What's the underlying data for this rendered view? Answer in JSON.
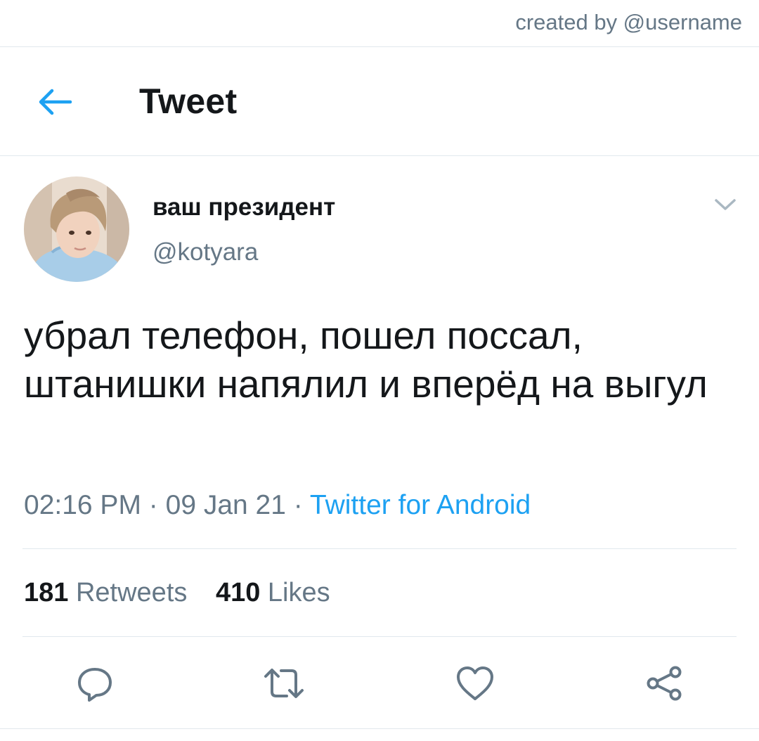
{
  "credit": "created by @username",
  "header": {
    "title": "Tweet",
    "back_icon": "arrow-left-icon"
  },
  "tweet": {
    "display_name": "ваш президент",
    "handle": "@kotyara",
    "text": "убрал телефон, пошел поссал, штанишки напялил и вперёд на выгул",
    "time": "02:16 PM",
    "date": "09 Jan 21",
    "separator": "·",
    "source": "Twitter for Android",
    "retweets_count": "181",
    "retweets_label": "Retweets",
    "likes_count": "410",
    "likes_label": "Likes"
  },
  "actions": [
    {
      "icon": "reply-icon"
    },
    {
      "icon": "retweet-icon"
    },
    {
      "icon": "like-icon"
    },
    {
      "icon": "share-icon"
    }
  ],
  "colors": {
    "accent": "#1da1f2",
    "text": "#14171a",
    "secondary": "#657786",
    "divider": "#e1e8ed"
  }
}
